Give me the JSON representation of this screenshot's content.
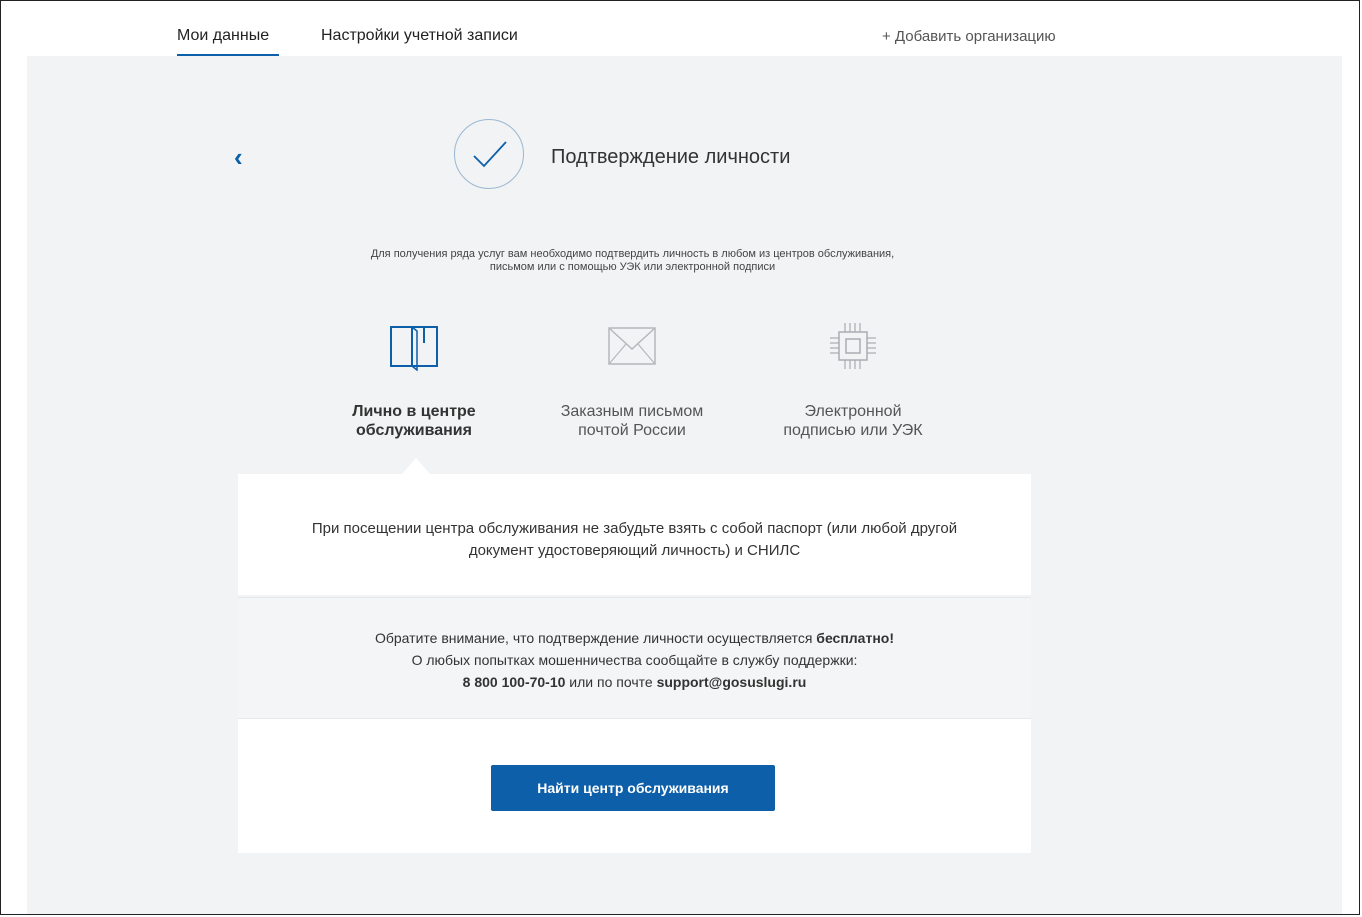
{
  "nav": {
    "tabs": [
      {
        "label": "Мои данные",
        "active": true
      },
      {
        "label": "Настройки учетной записи",
        "active": false
      }
    ],
    "add_org": "+ Добавить организацию"
  },
  "header": {
    "back_icon": "chevron-left-icon",
    "status_icon": "check-icon",
    "title": "Подтверждение личности"
  },
  "intro": {
    "line1": "Для получения ряда услуг вам необходимо подтвердить личность в любом из центров обслуживания,",
    "line2": "письмом или с помощью УЭК или электронной подписи"
  },
  "methods": [
    {
      "icon": "book-icon",
      "line1": "Лично в центре",
      "line2": "обслуживания",
      "active": true
    },
    {
      "icon": "envelope-icon",
      "line1": "Заказным письмом",
      "line2": "почтой России",
      "active": false
    },
    {
      "icon": "chip-icon",
      "line1": "Электронной",
      "line2": "подписью или УЭК",
      "active": false
    }
  ],
  "card": {
    "line1": "При посещении центра обслуживания не забудьте взять с собой паспорт (или любой другой",
    "line2": "документ удостоверяющий личность) и СНИЛС"
  },
  "notice": {
    "line1_pre": "Обратите внимание, что подтверждение личности осуществляется ",
    "line1_bold": "бесплатно!",
    "line2": "О любых попытках мошенничества сообщайте в службу поддержки:",
    "phone": "8 800 100-70-10",
    "line3_mid": " или по почте ",
    "email": "support@gosuslugi.ru"
  },
  "action": {
    "button": "Найти центр обслуживания"
  },
  "colors": {
    "accent": "#0c5fa8",
    "panel_bg": "#f1f3f4"
  }
}
